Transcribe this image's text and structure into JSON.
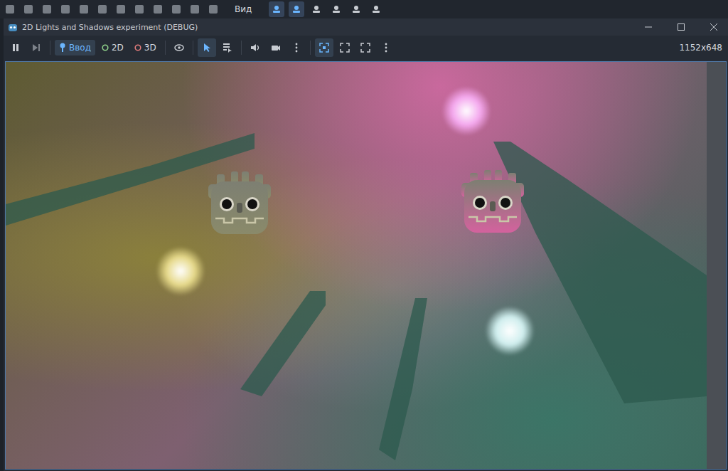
{
  "editor_toolbar": {
    "menu_label": "Вид",
    "tools": [
      {
        "selected": true
      },
      {
        "selected": true
      },
      {
        "selected": false
      },
      {
        "selected": false
      },
      {
        "selected": false
      },
      {
        "selected": false
      }
    ]
  },
  "window": {
    "title": "2D Lights and Shadows experiment (DEBUG)"
  },
  "game_toolbar": {
    "modes": [
      {
        "label": "Ввод",
        "selected": true,
        "color": "#6bb6ff"
      },
      {
        "label": "2D",
        "selected": false,
        "color": "#8fd18a"
      },
      {
        "label": "3D",
        "selected": false,
        "color": "#e07b7b"
      }
    ],
    "pick_tools": [
      {
        "selected": true
      },
      {
        "selected": false
      }
    ],
    "view_buttons": [
      {
        "selected": true
      },
      {
        "selected": false
      },
      {
        "selected": false
      }
    ],
    "resolution": "1152x648"
  },
  "scene": {
    "lights": [
      {
        "color": "#f4a8ee"
      },
      {
        "color": "#e6d98a"
      },
      {
        "color": "#cfeeee"
      }
    ],
    "robots": [
      {
        "color": "#8a8a6a"
      },
      {
        "color": "#d4629e"
      }
    ]
  }
}
